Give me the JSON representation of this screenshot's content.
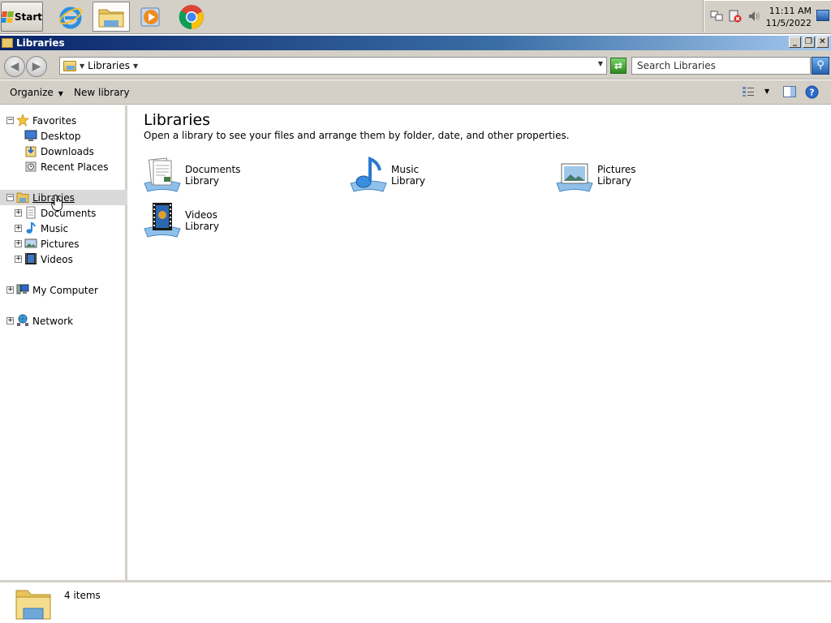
{
  "taskbar": {
    "start_label": "Start",
    "apps": [
      {
        "name": "internet-explorer"
      },
      {
        "name": "windows-explorer"
      },
      {
        "name": "media-player"
      },
      {
        "name": "chrome"
      }
    ],
    "clock_time": "11:11 AM",
    "clock_date": "11/5/2022"
  },
  "window": {
    "title": "Libraries",
    "minimize_label": "_",
    "restore_label": "❐",
    "close_label": "✕"
  },
  "address": {
    "crumb": "Libraries",
    "search_placeholder": "Search Libraries"
  },
  "toolbar": {
    "organize_label": "Organize",
    "new_library_label": "New library"
  },
  "nav": {
    "favorites": "Favorites",
    "desktop": "Desktop",
    "downloads": "Downloads",
    "recent": "Recent Places",
    "libraries": "Libraries",
    "documents": "Documents",
    "music": "Music",
    "pictures": "Pictures",
    "videos": "Videos",
    "computer": "My Computer",
    "network": "Network"
  },
  "content": {
    "title": "Libraries",
    "subtitle": "Open a library to see your files and arrange them by folder, date, and other properties.",
    "items": [
      {
        "name": "Documents",
        "type": "Library"
      },
      {
        "name": "Music",
        "type": "Library"
      },
      {
        "name": "Pictures",
        "type": "Library"
      },
      {
        "name": "Videos",
        "type": "Library"
      }
    ]
  },
  "status": {
    "count": "4 items"
  },
  "colors": {
    "titlebar_start": "#0a246a",
    "titlebar_end": "#a6caf0",
    "chrome": "#d4d0c8"
  }
}
